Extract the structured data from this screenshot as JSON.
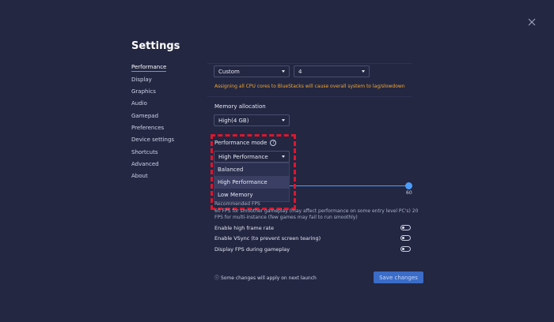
{
  "header": {
    "title": "Settings"
  },
  "sidebar": {
    "items": [
      {
        "label": "Performance",
        "active": true
      },
      {
        "label": "Display"
      },
      {
        "label": "Graphics"
      },
      {
        "label": "Audio"
      },
      {
        "label": "Gamepad"
      },
      {
        "label": "Preferences"
      },
      {
        "label": "Device settings"
      },
      {
        "label": "Shortcuts"
      },
      {
        "label": "Advanced"
      },
      {
        "label": "About"
      }
    ]
  },
  "cpu": {
    "preset_value": "Custom",
    "cores_value": "4",
    "warning": "Assigning all CPU cores to BlueStacks will cause overall system to lag/slowdown"
  },
  "memory": {
    "label": "Memory allocation",
    "value": "High(4 GB)"
  },
  "performance_mode": {
    "label": "Performance mode",
    "value": "High Performance",
    "options": [
      "Balanced",
      "High Performance",
      "Low Memory"
    ],
    "selected_index": 1
  },
  "fps": {
    "value": "60",
    "recommended_label": "Recommended FPS",
    "description": "60 FPS for smoother gameplay (may affect performance on some entry level PC's) 20 FPS for multi-instance (few games may fail to run smoothly)"
  },
  "toggles": [
    {
      "label": "Enable high frame rate",
      "on": false
    },
    {
      "label": "Enable VSync (to prevent screen tearing)",
      "on": false
    },
    {
      "label": "Display FPS during gameplay",
      "on": false
    }
  ],
  "footer": {
    "info_text": "Some changes will apply on next launch",
    "save_label": "Save changes"
  },
  "colors": {
    "background": "#232742",
    "accent": "#4a9dff",
    "warning": "#f0a530",
    "highlight": "#e0152c",
    "button": "#3a6cc8"
  },
  "icons": {
    "close": "close-icon",
    "help": "help-icon",
    "info": "info-icon",
    "caret": "chevron-down-icon"
  }
}
